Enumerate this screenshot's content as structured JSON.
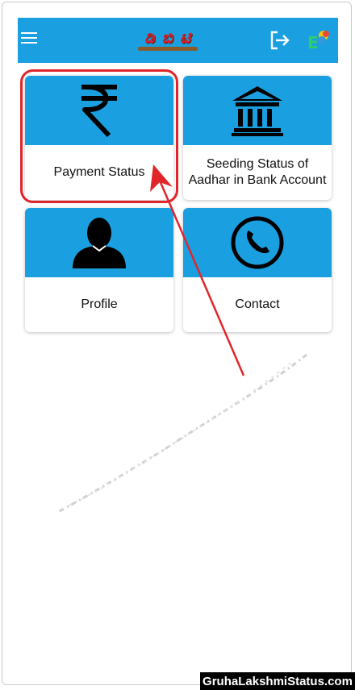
{
  "app_bar": {
    "logo_text": "ಡಿ ಬಿ ಟಿ",
    "menu_icon": "hamburger-menu-icon",
    "logout_icon": "logout-icon",
    "language_icon": "language-toggle-icon",
    "color": "#1aa0e0"
  },
  "cards": [
    {
      "label": "Payment Status",
      "icon": "rupee-icon"
    },
    {
      "label": "Seeding Status of Aadhar in Bank Account",
      "icon": "bank-icon"
    },
    {
      "label": "Profile",
      "icon": "user-icon"
    },
    {
      "label": "Contact",
      "icon": "phone-icon"
    }
  ],
  "annotation": {
    "highlight_color": "#e0262a"
  },
  "watermark": "GruhaLakshmiStatus.com"
}
